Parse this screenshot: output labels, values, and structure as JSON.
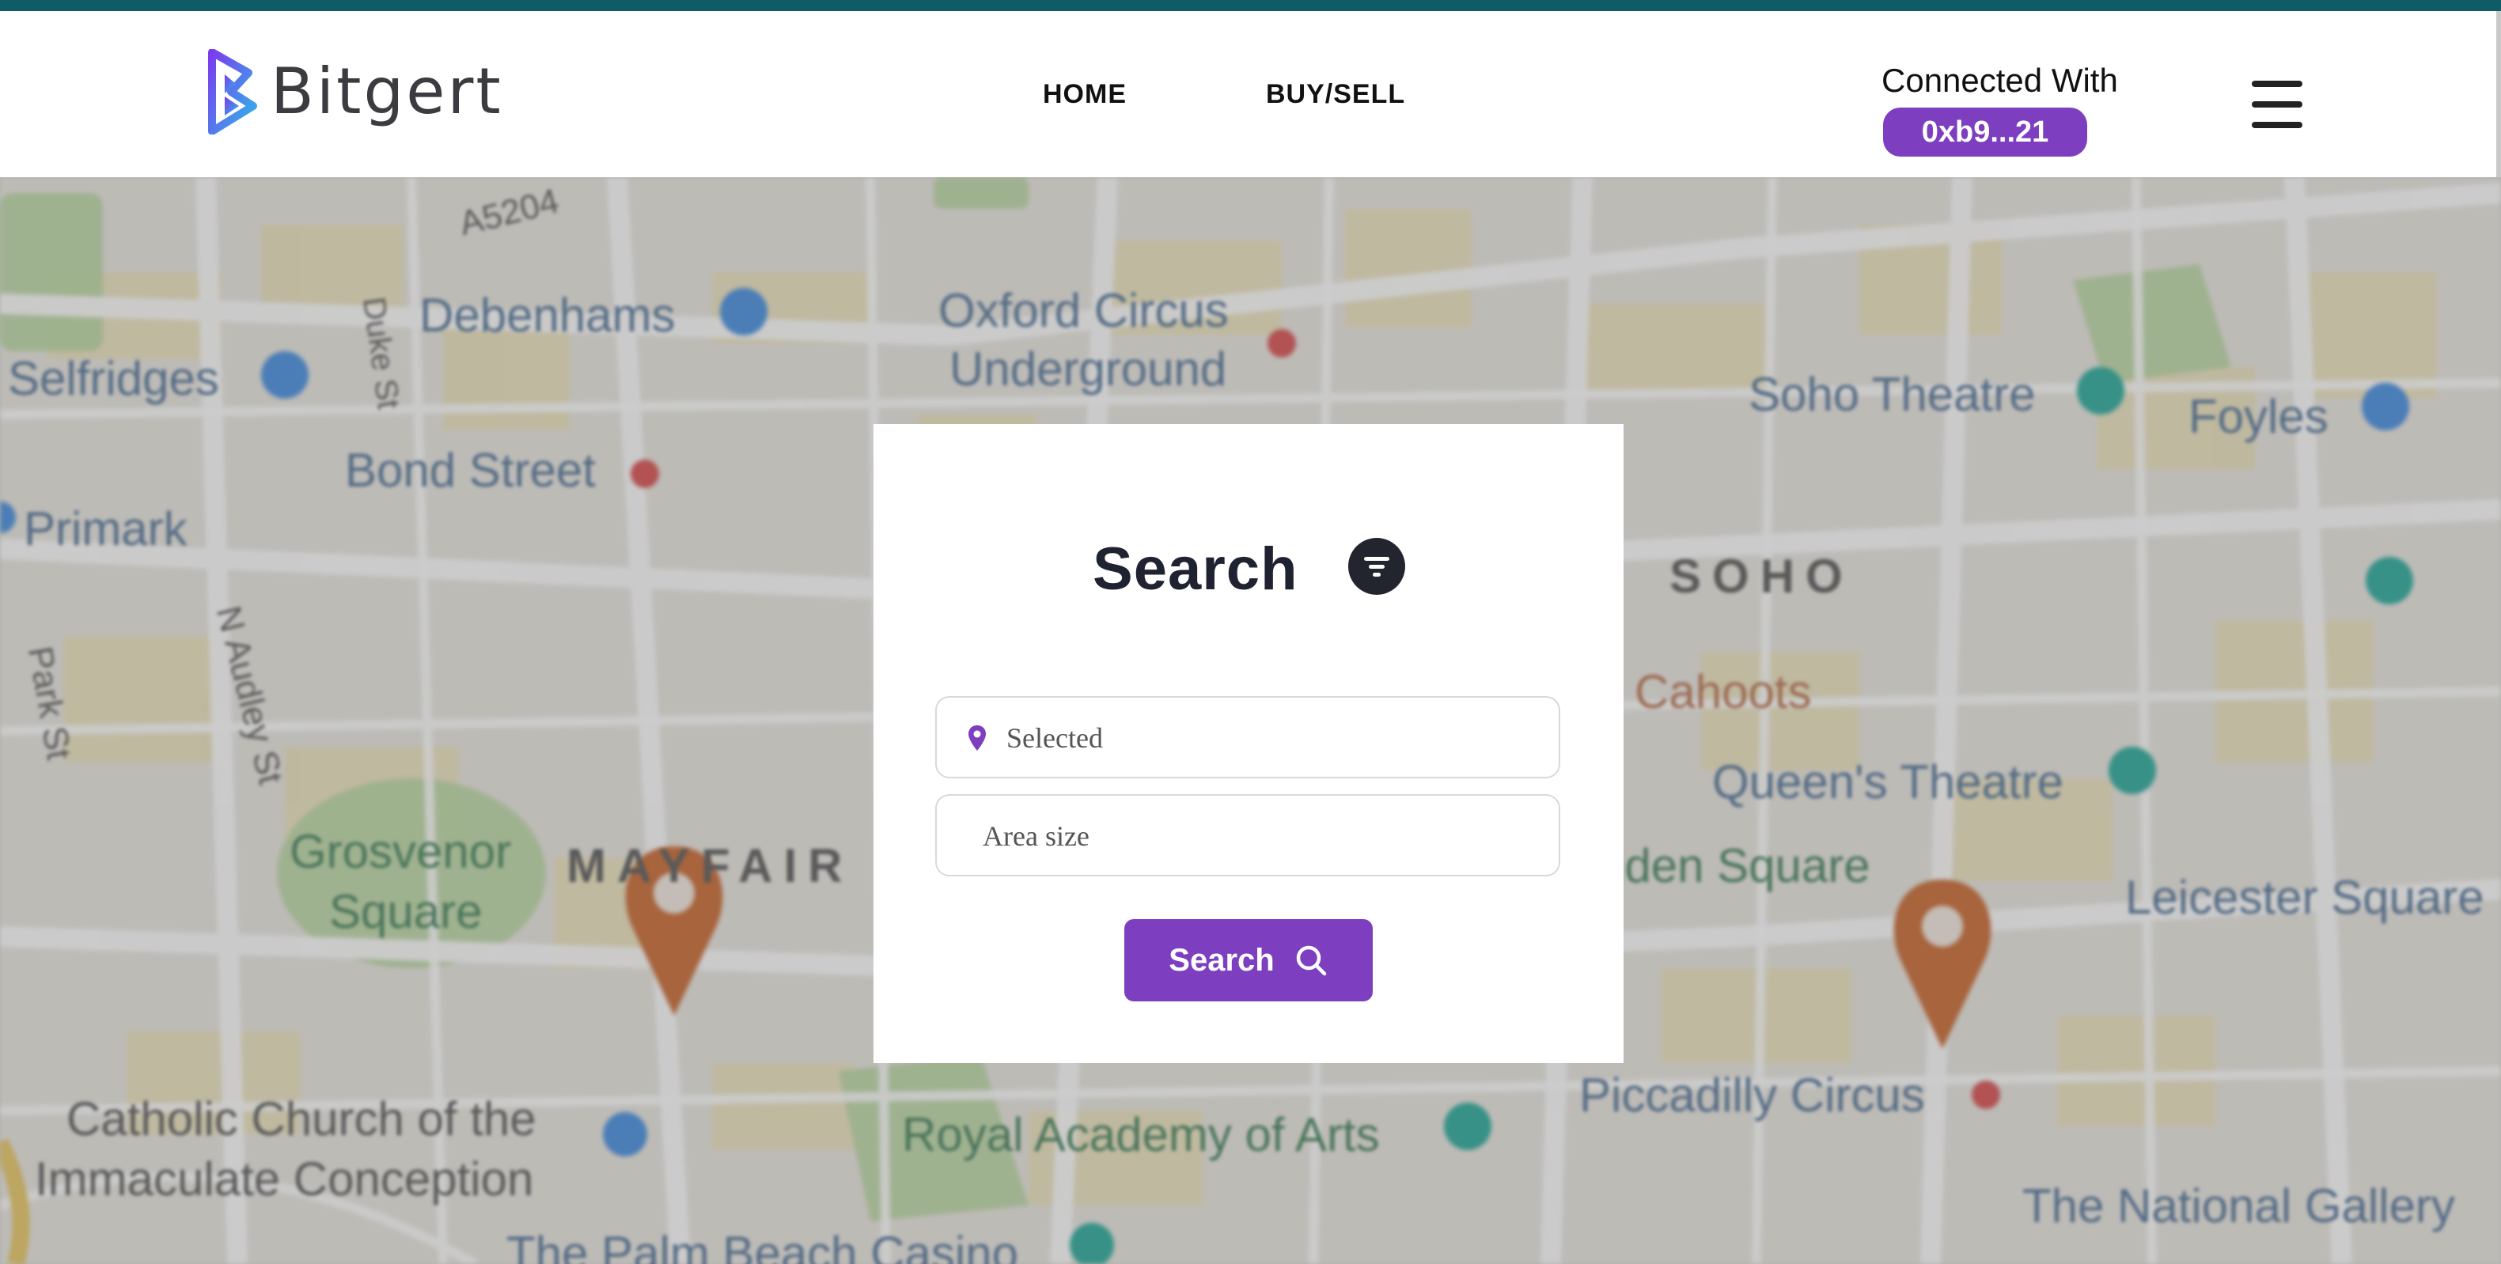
{
  "brand": {
    "name": "Bitgert",
    "logo_icon": "bitgert-b-icon"
  },
  "nav": {
    "items": [
      {
        "label": "HOME"
      },
      {
        "label": "BUY/SELL"
      }
    ]
  },
  "wallet": {
    "label": "Connected With",
    "address": "0xb9...21"
  },
  "menu": {
    "icon": "hamburger-menu-icon"
  },
  "map": {
    "labels": {
      "a5204": "A5204",
      "debenhams": "Debenhams",
      "selfridges": "Selfridges",
      "oxford": "Oxford Circus",
      "underground": "Underground",
      "soho_theatre": "Soho Theatre",
      "foyles": "Foyles",
      "bond_street": "Bond Street",
      "primark": "Primark",
      "soho": "SOHO",
      "cahoots": "Cahoots",
      "queens_theatre": "Queen's Theatre",
      "grosvenor": "Grosvenor",
      "square": "Square",
      "mayfair": "MAYFAIR",
      "golden_square": "Golden Square",
      "leicester": "Leicester Square",
      "catholic_1": "Catholic Church of the",
      "catholic_2": "Immaculate Conception",
      "royal_academy": "Royal Academy of Arts",
      "piccadilly": "Piccadilly Circus",
      "national_gallery": "The National Gallery",
      "palm_beach": "The Palm Beach Casino",
      "park_st": "Park St",
      "n_audley": "N Audley St",
      "duke_st": "Duke St"
    }
  },
  "search_card": {
    "title": "Search",
    "filter_icon": "filter-icon",
    "location": {
      "placeholder": "Selected",
      "icon": "location-pin-icon"
    },
    "area": {
      "placeholder": "Area size"
    },
    "button": {
      "label": "Search",
      "icon": "search-icon"
    }
  },
  "colors": {
    "accent": "#7d3fbf",
    "topbar": "#0f5c66",
    "pin": "#c8642a"
  }
}
